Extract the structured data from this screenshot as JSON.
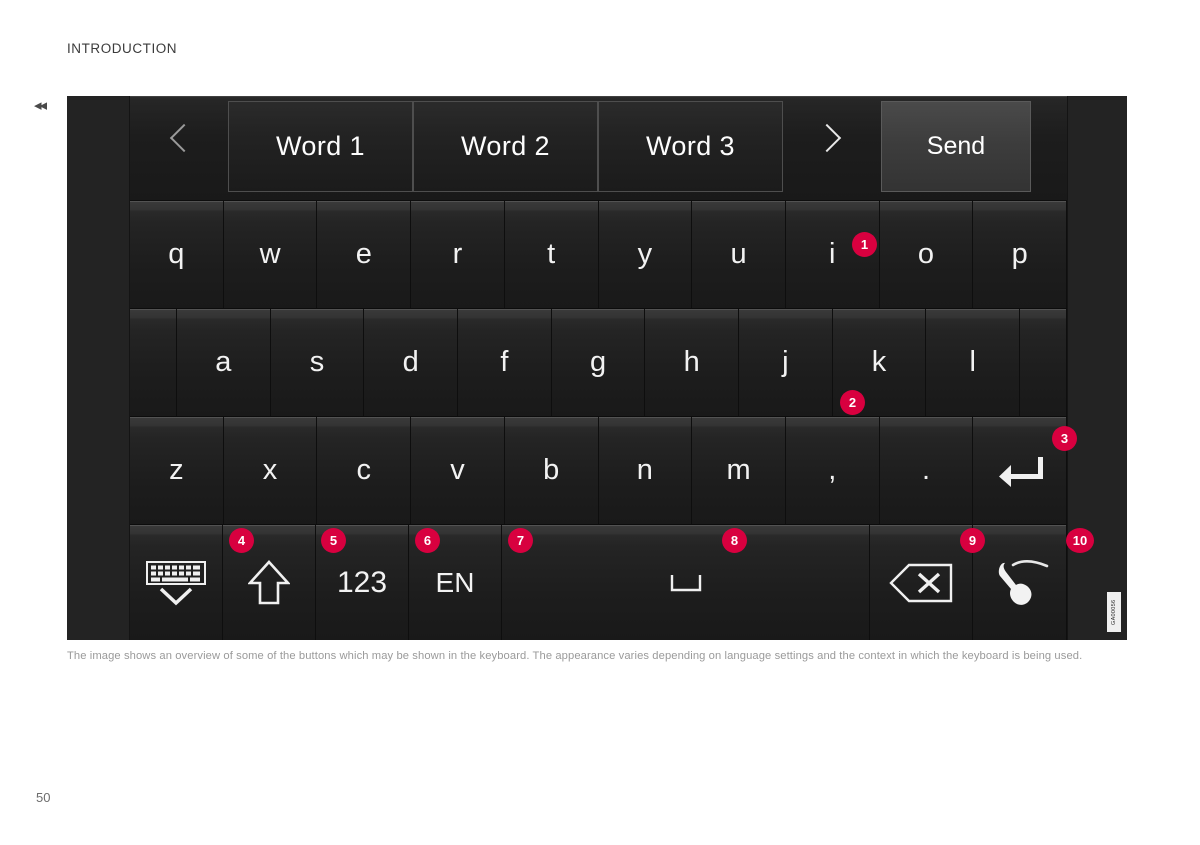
{
  "page": {
    "section_title": "INTRODUCTION",
    "page_number": "50",
    "back_marker": "◂◂",
    "figure_id": "GA00056",
    "caption": "The image shows an overview of some of the buttons which may be shown in the keyboard. The appearance varies depending on language settings and the context in which the keyboard is being used."
  },
  "keyboard": {
    "suggestion_bar": {
      "prev_arrow_icon": "chevron-left-icon",
      "next_arrow_icon": "chevron-right-icon",
      "words": [
        "Word 1",
        "Word 2",
        "Word 3"
      ],
      "send_label": "Send"
    },
    "row_1": [
      "q",
      "w",
      "e",
      "r",
      "t",
      "y",
      "u",
      "i",
      "o",
      "p"
    ],
    "row_2": [
      "a",
      "s",
      "d",
      "f",
      "g",
      "h",
      "j",
      "k",
      "l"
    ],
    "row_3": [
      "z",
      "x",
      "c",
      "v",
      "b",
      "n",
      "m",
      ",",
      "."
    ],
    "enter_icon": "enter-return-icon",
    "function_row": {
      "hide_keyboard_icon": "hide-keyboard-icon",
      "shift_icon": "shift-arrow-icon",
      "numbers_label": "123",
      "language_label": "EN",
      "space_icon": "space-bar-icon",
      "backspace_icon": "backspace-icon",
      "handwriting_icon": "handwriting-finger-icon"
    }
  },
  "callouts": [
    {
      "id": "1",
      "number": "1"
    },
    {
      "id": "2",
      "number": "2"
    },
    {
      "id": "3",
      "number": "3"
    },
    {
      "id": "4",
      "number": "4"
    },
    {
      "id": "5",
      "number": "5"
    },
    {
      "id": "6",
      "number": "6"
    },
    {
      "id": "7",
      "number": "7"
    },
    {
      "id": "8",
      "number": "8"
    },
    {
      "id": "9",
      "number": "9"
    },
    {
      "id": "10",
      "number": "10"
    }
  ],
  "colors": {
    "badge": "#d8003f",
    "panel": "#171717",
    "bezel": "#232323",
    "key_text": "#f2f2f2"
  }
}
